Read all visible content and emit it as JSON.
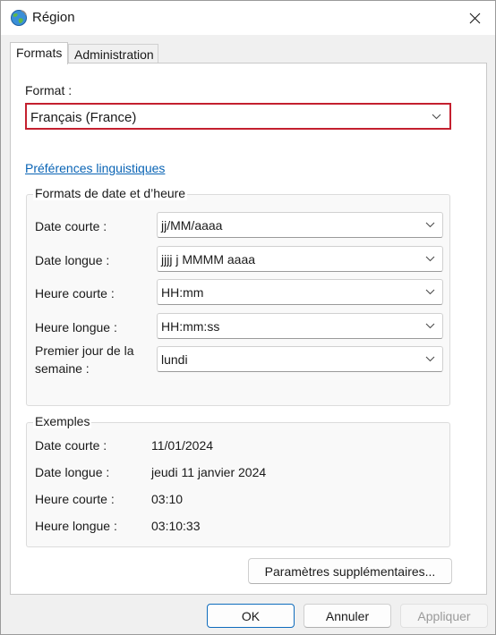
{
  "window": {
    "title": "Région",
    "icon": "globe-icon",
    "close_icon": "close-icon"
  },
  "tabs": [
    {
      "label": "Formats",
      "active": true
    },
    {
      "label": "Administration",
      "active": false
    }
  ],
  "format": {
    "label": "Format :",
    "value": "Français (France)",
    "highlight_color": "#c4202f"
  },
  "link": {
    "label": "Préférences linguistiques",
    "color": "#0a64b5"
  },
  "date_time_formats": {
    "title": "Formats de date et d’heure",
    "rows": [
      {
        "label": "Date courte :",
        "value": "jj/MM/aaaa"
      },
      {
        "label": "Date longue :",
        "value": "jjjj j MMMM aaaa"
      },
      {
        "label": "Heure courte :",
        "value": "HH:mm"
      },
      {
        "label": "Heure longue :",
        "value": "HH:mm:ss"
      },
      {
        "label_line1": "Premier jour de la",
        "label_line2": "semaine :",
        "value": "lundi"
      }
    ]
  },
  "examples": {
    "title": "Exemples",
    "rows": [
      {
        "label": "Date courte :",
        "value": "11/01/2024"
      },
      {
        "label": "Date longue :",
        "value": "jeudi 11 janvier 2024"
      },
      {
        "label": "Heure courte :",
        "value": "03:10"
      },
      {
        "label": "Heure longue :",
        "value": "03:10:33"
      }
    ]
  },
  "buttons": {
    "more": "Paramètres supplémentaires...",
    "ok": "OK",
    "cancel": "Annuler",
    "apply": "Appliquer",
    "apply_disabled": true
  }
}
